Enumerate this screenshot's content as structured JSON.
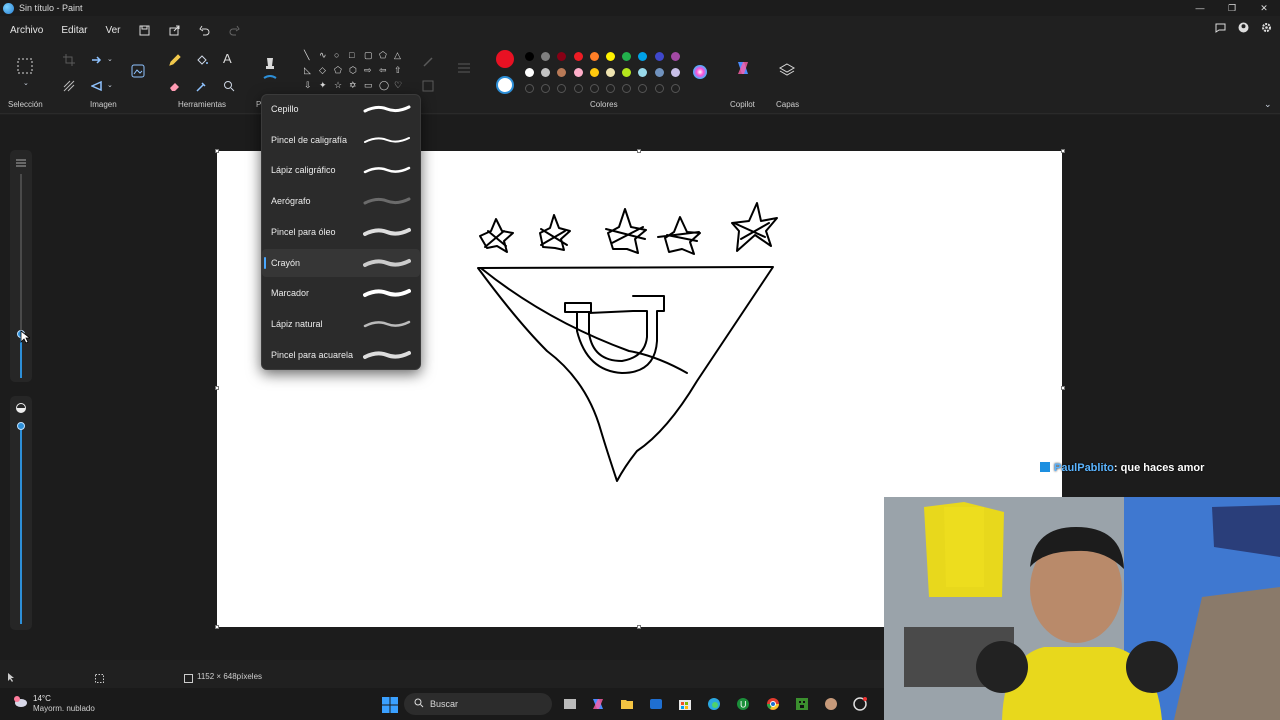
{
  "window": {
    "title": "Sin título - Paint",
    "controls": [
      "—",
      "❐",
      "✕"
    ]
  },
  "menu": {
    "items": [
      "Archivo",
      "Editar",
      "Ver"
    ]
  },
  "ribbon": {
    "groups": [
      "Selección",
      "Imagen",
      "Herramientas",
      "P",
      "Colores",
      "Copilot",
      "Capas"
    ]
  },
  "colors": {
    "primary": "#e81123",
    "secondary": "#ffffff",
    "row1": [
      "#000000",
      "#7f7f7f",
      "#880015",
      "#ed1c24",
      "#ff7f27",
      "#fff200",
      "#22b14c",
      "#00a2e8",
      "#3f48cc",
      "#a349a4"
    ],
    "row2": [
      "#ffffff",
      "#c3c3c3",
      "#b97a57",
      "#ffaec9",
      "#ffc90e",
      "#efe4b0",
      "#b5e61d",
      "#99d9ea",
      "#7092be",
      "#c8bfe7"
    ]
  },
  "brush_menu": {
    "items": [
      {
        "label": "Cepillo",
        "active": false
      },
      {
        "label": "Pincel de caligrafía",
        "active": false
      },
      {
        "label": "Lápiz caligráfico",
        "active": false
      },
      {
        "label": "Aerógrafo",
        "active": false
      },
      {
        "label": "Pincel para óleo",
        "active": false
      },
      {
        "label": "Crayón",
        "active": true
      },
      {
        "label": "Marcador",
        "active": false
      },
      {
        "label": "Lápiz natural",
        "active": false
      },
      {
        "label": "Pincel para acuarela",
        "active": false
      }
    ]
  },
  "status": {
    "canvas_size": "1152 × 648píxeles"
  },
  "chat": {
    "user": "PaulPablito",
    "message": ": que haces amor"
  },
  "weather": {
    "temp": "14°C",
    "desc": "Mayorm. nublado"
  },
  "taskbar": {
    "search_placeholder": "Buscar"
  }
}
